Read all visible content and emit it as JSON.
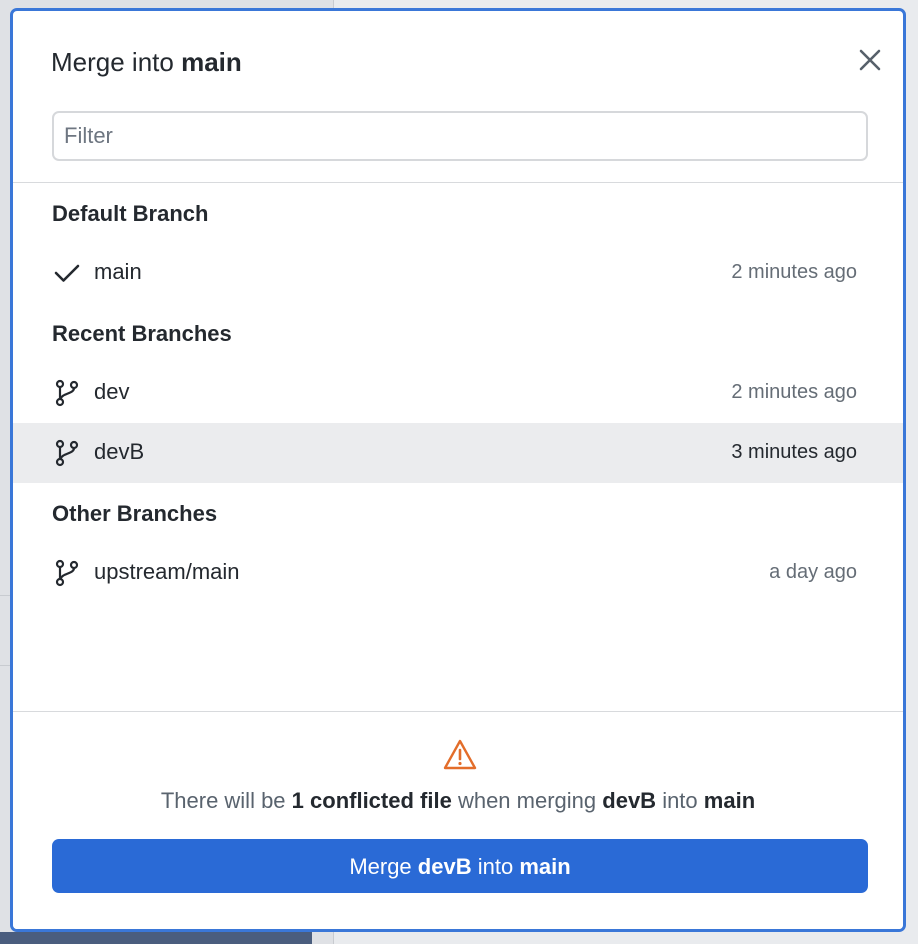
{
  "dialog": {
    "title_prefix": "Merge into",
    "title_branch": "main",
    "filter_placeholder": "Filter"
  },
  "sections": [
    {
      "label": "Default Branch",
      "items": [
        {
          "name": "main",
          "time": "2 minutes ago",
          "icon": "check-icon"
        }
      ]
    },
    {
      "label": "Recent Branches",
      "items": [
        {
          "name": "dev",
          "time": "2 minutes ago",
          "icon": "git-branch-icon"
        },
        {
          "name": "devB",
          "time": "3 minutes ago",
          "icon": "git-branch-icon",
          "selected": true
        }
      ]
    },
    {
      "label": "Other Branches",
      "items": [
        {
          "name": "upstream/main",
          "time": "a day ago",
          "icon": "git-branch-icon"
        }
      ]
    }
  ],
  "warning": {
    "icon": "warning-icon",
    "prefix": "There will be",
    "count_text": "1 conflicted file",
    "middle": "when merging",
    "source": "devB",
    "into": "into",
    "target": "main"
  },
  "merge_button": {
    "prefix": "Merge",
    "source": "devB",
    "into": "into",
    "target": "main"
  },
  "colors": {
    "accent": "#2a6ad6",
    "dialog_border": "#3a77d8",
    "warning": "#e36d2a",
    "selected_row": "#ebecee"
  }
}
